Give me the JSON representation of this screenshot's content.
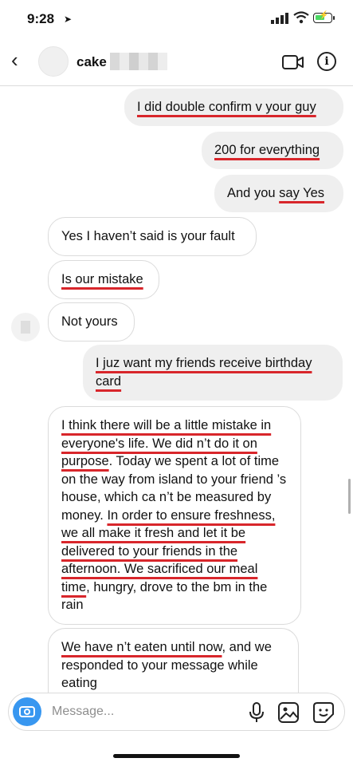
{
  "status_bar": {
    "time": "9:28",
    "location_icon": "location-arrow-icon"
  },
  "header": {
    "contact_name": "cake",
    "back_icon": "chevron-left-icon",
    "video_icon": "video-call-icon",
    "info_icon": "info-icon",
    "info_glyph": "i"
  },
  "messages": [
    {
      "side": "sent",
      "parts": [
        {
          "text": "I did double confirm v your guy",
          "u": true
        }
      ]
    },
    {
      "side": "sent",
      "parts": [
        {
          "text": "200 for everything",
          "u": true
        }
      ]
    },
    {
      "side": "sent",
      "parts": [
        {
          "text": "And you ",
          "u": false
        },
        {
          "text": "say Yes",
          "u": true
        }
      ]
    },
    {
      "side": "received",
      "parts": [
        {
          "text": "Yes I haven’t said is your fault",
          "u": false
        }
      ]
    },
    {
      "side": "received",
      "parts": [
        {
          "text": "Is our mistake",
          "u": true
        }
      ]
    },
    {
      "side": "received",
      "parts": [
        {
          "text": "Not yours",
          "u": false
        }
      ]
    },
    {
      "side": "sent",
      "parts": [
        {
          "text": "I juz want my friends receive birthday card",
          "u": true
        }
      ]
    },
    {
      "side": "received",
      "parts": [
        {
          "text": "I think there will be a little mistake in everyone's life. We did n’t do it on purpose",
          "u": true
        },
        {
          "text": ". Today we spent a lot of time on the way from island to your friend ’s house, which ca n’t be measured by money. ",
          "u": false
        },
        {
          "text": "In order to ensure freshness, we all make it fresh and let it be delivered to your friends in the afternoon. We sacrificed our meal time",
          "u": true
        },
        {
          "text": ", hungry, drove to the bm  in the rain",
          "u": false
        }
      ]
    },
    {
      "side": "received",
      "parts": [
        {
          "text": "We have n’t eaten until now",
          "u": true
        },
        {
          "text": ", and we responded to your message while eating",
          "u": false
        }
      ]
    }
  ],
  "composer": {
    "placeholder": "Message...",
    "camera_icon": "camera-icon",
    "mic_icon": "microphone-icon",
    "gallery_icon": "gallery-icon",
    "sticker_icon": "sticker-icon"
  },
  "colors": {
    "sent_bubble": "#efefef",
    "underline": "#d8262b",
    "camera_button": "#3897f0"
  }
}
